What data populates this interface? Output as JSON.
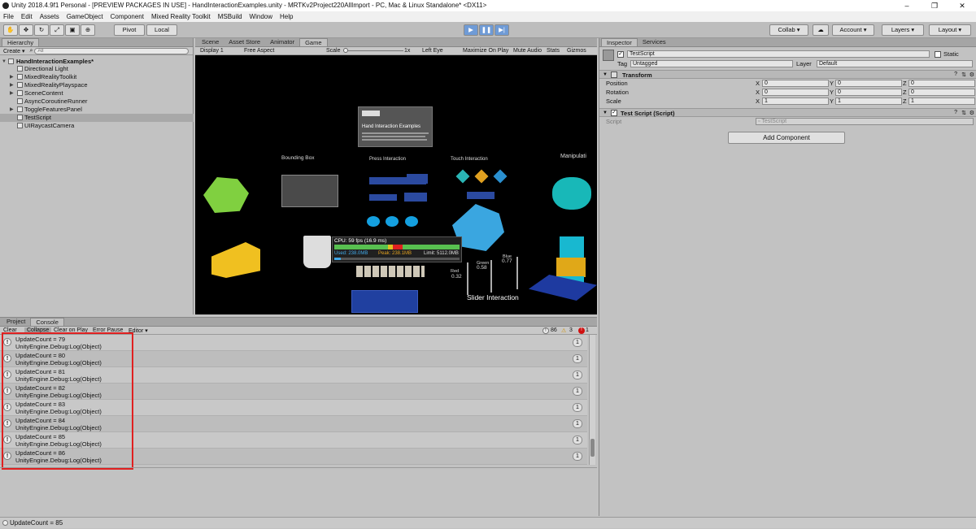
{
  "window": {
    "title": "Unity 2018.4.9f1 Personal - [PREVIEW PACKAGES IN USE] - HandInteractionExamples.unity - MRTKv2Project220AllImport - PC, Mac & Linux Standalone* <DX11>",
    "minimize": "–",
    "maximize": "❐",
    "close": "✕"
  },
  "menu": [
    "File",
    "Edit",
    "Assets",
    "GameObject",
    "Component",
    "Mixed Reality Toolkit",
    "MSBuild",
    "Window",
    "Help"
  ],
  "toolbar": {
    "pivot": "Pivot",
    "local": "Local",
    "collab": "Collab ▾",
    "account": "Account",
    "layers": "Layers",
    "layout": "Layout"
  },
  "hierarchy": {
    "tab": "Hierarchy",
    "create": "Create ▾",
    "search_placeholder": "All",
    "scene": "HandInteractionExamples*",
    "items": [
      "Directional Light",
      "MixedRealityToolkit",
      "MixedRealityPlayspace",
      "SceneContent",
      "AsyncCoroutineRunner",
      "ToggleFeaturesPanel",
      "TestScript",
      "UIRaycastCamera"
    ]
  },
  "game_tabs": [
    "Scene",
    "Asset Store",
    "Animator",
    "Game"
  ],
  "game_bar": {
    "display": "Display 1",
    "aspect": "Free Aspect",
    "scale_label": "Scale",
    "scale_value": "1x",
    "eye": "Left Eye",
    "max_on_play": "Maximize On Play",
    "mute": "Mute Audio",
    "stats": "Stats",
    "gizmos": "Gizmos"
  },
  "game_scene": {
    "panel_title": "Hand Interaction Examples",
    "bounding_box": "Bounding Box",
    "press_interaction": "Press Interaction",
    "touch_interaction": "Touch Interaction",
    "manipulation": "Manipulati",
    "slider_interaction": "Slider Interaction",
    "profiler_cpu": "CPU: 59 fps (16.9 ms)",
    "profiler_used": "Used: 238.0MB",
    "profiler_peak": "Peak: 238.1MB",
    "profiler_limit": "Limit: 5112.0MB",
    "slider_red": "Red",
    "slider_red_val": "0.32",
    "slider_green": "Green",
    "slider_green_val": "0.58",
    "slider_blue": "Blue",
    "slider_blue_val": "0.77"
  },
  "inspector": {
    "tabs": [
      "Inspector",
      "Services"
    ],
    "object_name": "TestScript",
    "static": "Static",
    "tag_label": "Tag",
    "tag_value": "Untagged",
    "layer_label": "Layer",
    "layer_value": "Default",
    "transform": "Transform",
    "rows": [
      {
        "label": "Position",
        "x": "0",
        "y": "0",
        "z": "0"
      },
      {
        "label": "Rotation",
        "x": "0",
        "y": "0",
        "z": "0"
      },
      {
        "label": "Scale",
        "x": "1",
        "y": "1",
        "z": "1"
      }
    ],
    "script_component": "Test Script (Script)",
    "script_label": "Script",
    "script_value": "TestScript",
    "add_component": "Add Component"
  },
  "console": {
    "tabs": [
      "Project",
      "Console"
    ],
    "buttons": [
      "Clear",
      "Collapse",
      "Clear on Play",
      "Error Pause",
      "Editor ▾"
    ],
    "info_count": "86",
    "warn_count": "3",
    "error_count": "1",
    "logs": [
      {
        "line1": "UpdateCount = 79",
        "line2": "UnityEngine.Debug:Log(Object)",
        "count": "1"
      },
      {
        "line1": "UpdateCount = 80",
        "line2": "UnityEngine.Debug:Log(Object)",
        "count": "1"
      },
      {
        "line1": "UpdateCount = 81",
        "line2": "UnityEngine.Debug:Log(Object)",
        "count": "1"
      },
      {
        "line1": "UpdateCount = 82",
        "line2": "UnityEngine.Debug:Log(Object)",
        "count": "1"
      },
      {
        "line1": "UpdateCount = 83",
        "line2": "UnityEngine.Debug:Log(Object)",
        "count": "1"
      },
      {
        "line1": "UpdateCount = 84",
        "line2": "UnityEngine.Debug:Log(Object)",
        "count": "1"
      },
      {
        "line1": "UpdateCount = 85",
        "line2": "UnityEngine.Debug:Log(Object)",
        "count": "1"
      },
      {
        "line1": "UpdateCount = 86",
        "line2": "UnityEngine.Debug:Log(Object)",
        "count": "1"
      }
    ]
  },
  "status": "UpdateCount = 85",
  "colors": {
    "highlight": "#e02020",
    "play_blue": "#6f9bd6"
  }
}
